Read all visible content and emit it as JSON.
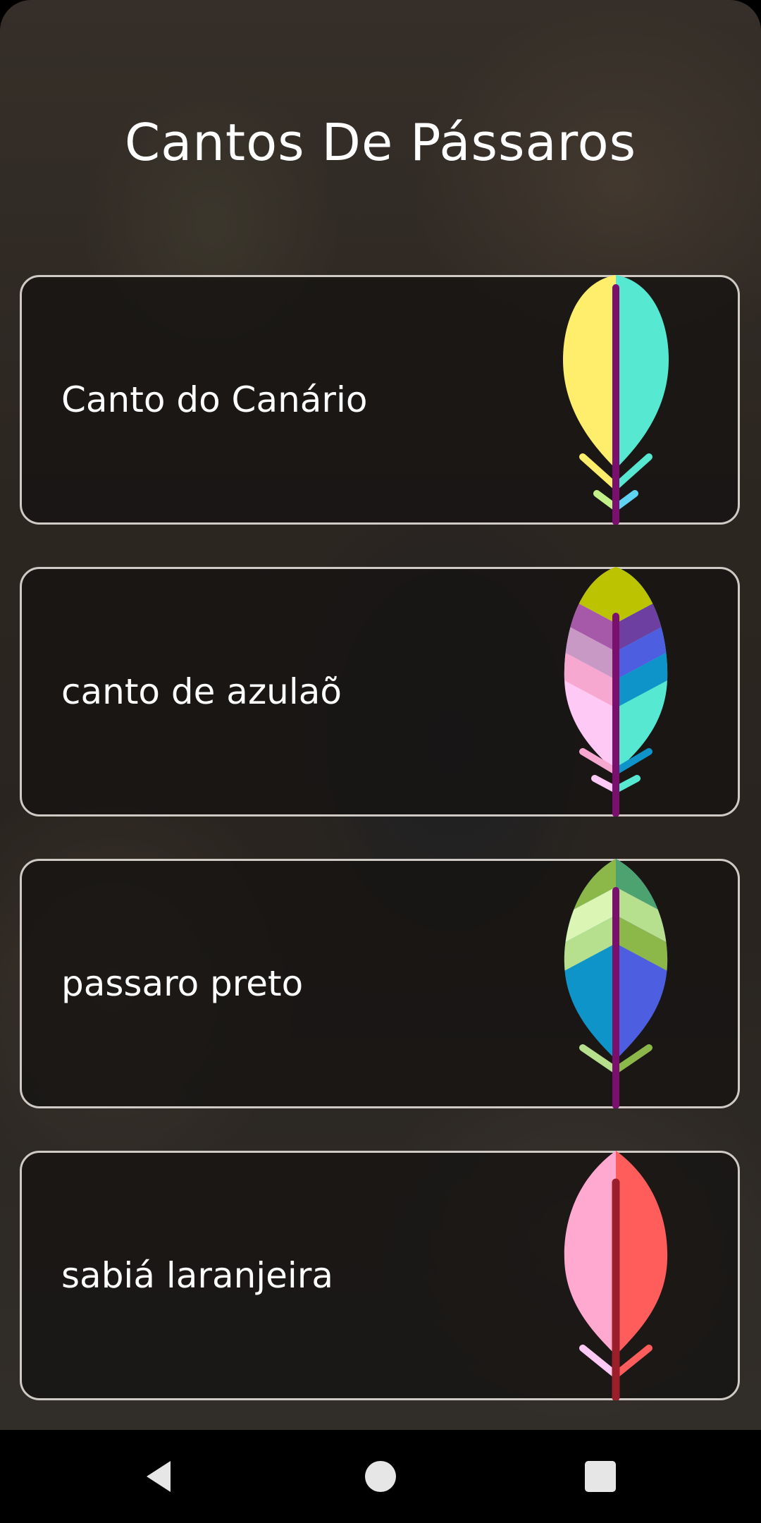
{
  "app": {
    "title": "Cantos De Pássaros"
  },
  "cards": [
    {
      "label": "Canto do Canário",
      "icon": "feather-yellow-teal-icon"
    },
    {
      "label": "canto de azulaõ",
      "icon": "feather-multicolor-blue-icon"
    },
    {
      "label": "passaro preto",
      "icon": "feather-green-blue-icon"
    },
    {
      "label": "sabiá laranjeira",
      "icon": "feather-pink-red-icon"
    }
  ],
  "navbar": {
    "back": "back-icon",
    "home": "home-icon",
    "recents": "recents-icon"
  },
  "colors": {
    "card_border": "#cfcac4",
    "stem_purple": "#7a0f6e",
    "stem_red": "#9b1f2a"
  }
}
